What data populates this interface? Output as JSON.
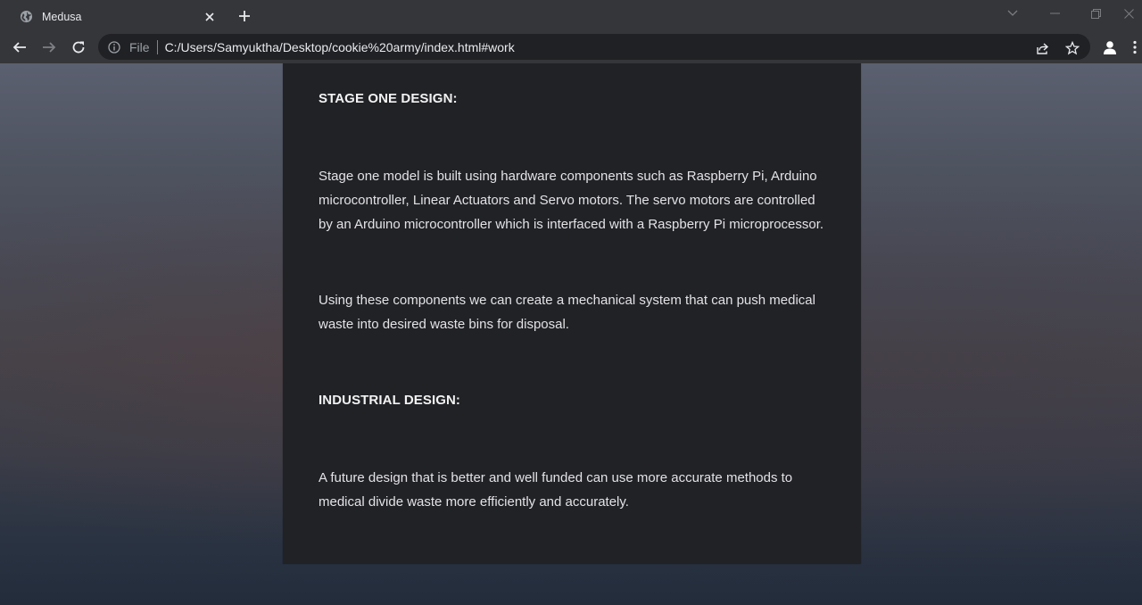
{
  "browser": {
    "tab": {
      "title": "Medusa",
      "favicon": "globe-icon"
    },
    "address": {
      "scheme_label": "File",
      "url": "C:/Users/Samyuktha/Desktop/cookie%20army/index.html#work"
    }
  },
  "article": {
    "sections": [
      {
        "heading": "STAGE ONE DESIGN:",
        "paragraphs": [
          "Stage one model is built using hardware components such as Raspberry Pi, Arduino microcontroller, Linear Actuators and Servo motors. The servo motors are controlled by an Arduino microcontroller which is interfaced with a Raspberry Pi microprocessor.",
          "Using these components we can create a mechanical system that can push medical waste into desired waste bins for disposal."
        ]
      },
      {
        "heading": "INDUSTRIAL DESIGN:",
        "paragraphs": [
          "A future design that is better and well funded can use more accurate methods to medical divide waste more efficiently and accurately."
        ]
      }
    ]
  }
}
